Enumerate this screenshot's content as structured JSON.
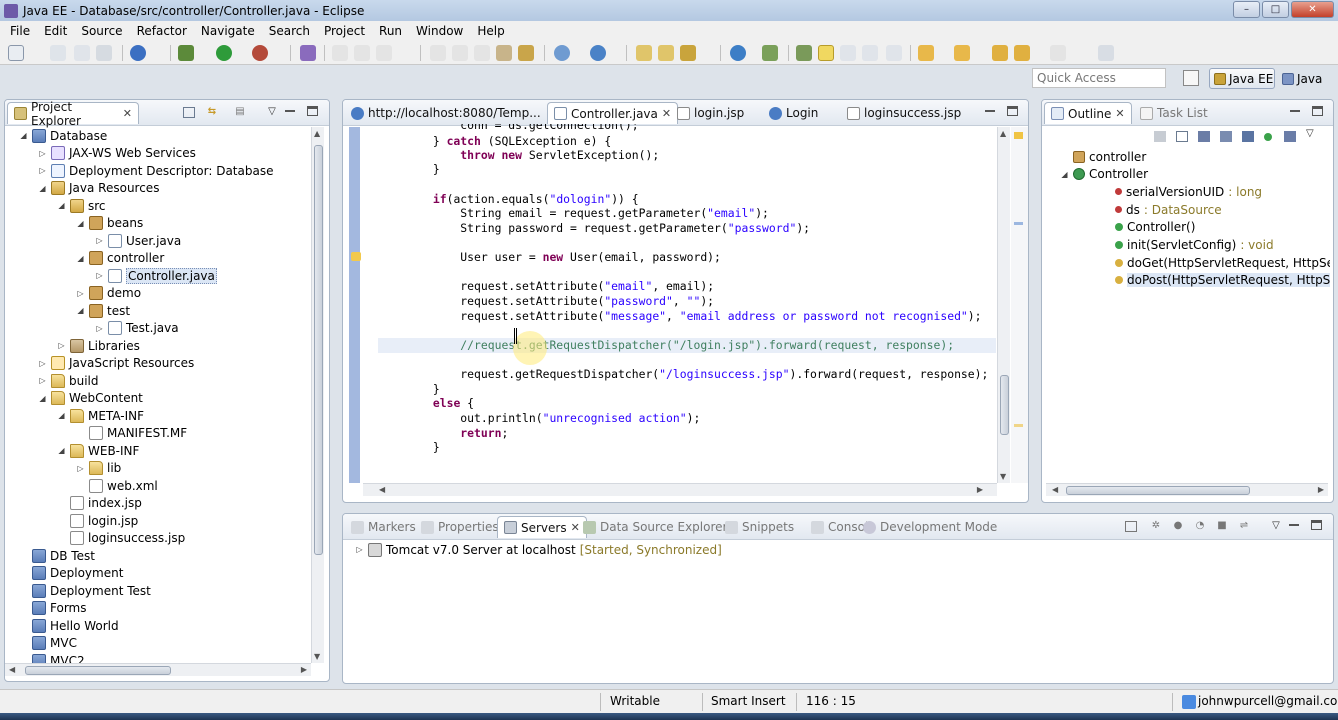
{
  "window": {
    "title": "Java EE - Database/src/controller/Controller.java - Eclipse",
    "controls": [
      "–",
      "□",
      "✕"
    ]
  },
  "menu": [
    "File",
    "Edit",
    "Source",
    "Refactor",
    "Navigate",
    "Search",
    "Project",
    "Run",
    "Window",
    "Help"
  ],
  "quick_access": {
    "placeholder": "Quick Access"
  },
  "perspectives": [
    {
      "label": "Java EE",
      "active": true
    },
    {
      "label": "Java",
      "active": false
    }
  ],
  "project_explorer": {
    "title": "Project Explorer",
    "tree": [
      {
        "label": "Database",
        "icon": "project-icon",
        "twisty": "◢",
        "indent": 0
      },
      {
        "label": "JAX-WS Web Services",
        "icon": "webservice-icon",
        "twisty": "▷",
        "indent": 1
      },
      {
        "label": "Deployment Descriptor: Database",
        "icon": "descriptor-icon",
        "twisty": "▷",
        "indent": 1
      },
      {
        "label": "Java Resources",
        "icon": "java-resources-icon",
        "twisty": "◢",
        "indent": 1
      },
      {
        "label": "src",
        "icon": "source-folder-icon",
        "twisty": "◢",
        "indent": 2
      },
      {
        "label": "beans",
        "icon": "package-icon",
        "twisty": "◢",
        "indent": 3
      },
      {
        "label": "User.java",
        "icon": "java-file-icon",
        "twisty": "▷",
        "indent": 4
      },
      {
        "label": "controller",
        "icon": "package-icon",
        "twisty": "◢",
        "indent": 3
      },
      {
        "label": "Controller.java",
        "icon": "java-file-icon",
        "twisty": "▷",
        "indent": 4,
        "selected": true
      },
      {
        "label": "demo",
        "icon": "package-icon",
        "twisty": "▷",
        "indent": 3
      },
      {
        "label": "test",
        "icon": "package-icon",
        "twisty": "◢",
        "indent": 3
      },
      {
        "label": "Test.java",
        "icon": "java-file-icon",
        "twisty": "▷",
        "indent": 4
      },
      {
        "label": "Libraries",
        "icon": "library-icon",
        "twisty": "▷",
        "indent": 2
      },
      {
        "label": "JavaScript Resources",
        "icon": "javascript-icon",
        "twisty": "▷",
        "indent": 1
      },
      {
        "label": "build",
        "icon": "folder-icon",
        "twisty": "▷",
        "indent": 1
      },
      {
        "label": "WebContent",
        "icon": "folder-icon",
        "twisty": "◢",
        "indent": 1
      },
      {
        "label": "META-INF",
        "icon": "folder-icon",
        "twisty": "◢",
        "indent": 2
      },
      {
        "label": "MANIFEST.MF",
        "icon": "file-icon",
        "twisty": "",
        "indent": 3
      },
      {
        "label": "WEB-INF",
        "icon": "folder-icon",
        "twisty": "◢",
        "indent": 2
      },
      {
        "label": "lib",
        "icon": "folder-icon",
        "twisty": "▷",
        "indent": 3
      },
      {
        "label": "web.xml",
        "icon": "xml-file-icon",
        "twisty": "",
        "indent": 3
      },
      {
        "label": "index.jsp",
        "icon": "file-icon",
        "twisty": "",
        "indent": 2
      },
      {
        "label": "login.jsp",
        "icon": "file-icon",
        "twisty": "",
        "indent": 2
      },
      {
        "label": "loginsuccess.jsp",
        "icon": "file-icon",
        "twisty": "",
        "indent": 2
      },
      {
        "label": "DB Test",
        "icon": "project-icon",
        "twisty": "",
        "indent": 0
      },
      {
        "label": "Deployment",
        "icon": "project-icon",
        "twisty": "",
        "indent": 0
      },
      {
        "label": "Deployment Test",
        "icon": "project-icon",
        "twisty": "",
        "indent": 0
      },
      {
        "label": "Forms",
        "icon": "project-icon",
        "twisty": "",
        "indent": 0
      },
      {
        "label": "Hello World",
        "icon": "project-icon",
        "twisty": "",
        "indent": 0
      },
      {
        "label": "MVC",
        "icon": "project-icon",
        "twisty": "",
        "indent": 0
      },
      {
        "label": "MVC2",
        "icon": "project-icon",
        "twisty": "",
        "indent": 0
      }
    ]
  },
  "editor": {
    "tabs": [
      {
        "label": "http://localhost:8080/Temp...",
        "icon": "browser-icon",
        "active": false
      },
      {
        "label": "Controller.java",
        "icon": "java-file-icon",
        "active": true
      },
      {
        "label": "login.jsp",
        "icon": "jsp-file-icon",
        "active": false
      },
      {
        "label": "Login",
        "icon": "browser-icon",
        "active": false
      },
      {
        "label": "loginsuccess.jsp",
        "icon": "jsp-file-icon",
        "active": false
      }
    ],
    "code": [
      {
        "text": "            conn = ds.getConnection();",
        "parts": []
      },
      {
        "text": "        } catch (SQLException e) {",
        "parts": [
          [
            "        } ",
            ""
          ],
          [
            "catch",
            "k"
          ],
          [
            " (SQLException e) {",
            ""
          ]
        ]
      },
      {
        "text": "            throw new ServletException();",
        "parts": [
          [
            "            ",
            ""
          ],
          [
            "throw",
            "k"
          ],
          [
            " ",
            ""
          ],
          [
            "new",
            "k"
          ],
          [
            " ServletException();",
            ""
          ]
        ]
      },
      {
        "text": "        }",
        "parts": []
      },
      {
        "text": "",
        "parts": []
      },
      {
        "text": "        if(action.equals(\"dologin\")) {",
        "parts": [
          [
            "        ",
            ""
          ],
          [
            "if",
            "k"
          ],
          [
            "(action.equals(",
            ""
          ],
          [
            "\"dologin\"",
            "s"
          ],
          [
            ")) {",
            ""
          ]
        ]
      },
      {
        "text": "            String email = request.getParameter(\"email\");",
        "parts": [
          [
            "            String email = request.getParameter(",
            ""
          ],
          [
            "\"email\"",
            "s"
          ],
          [
            ");",
            ""
          ]
        ]
      },
      {
        "text": "            String password = request.getParameter(\"password\");",
        "parts": [
          [
            "            String password = request.getParameter(",
            ""
          ],
          [
            "\"password\"",
            "s"
          ],
          [
            ");",
            ""
          ]
        ]
      },
      {
        "text": "",
        "parts": []
      },
      {
        "text": "            User user = new User(email, password);",
        "parts": [
          [
            "            User user = ",
            ""
          ],
          [
            "new",
            "k"
          ],
          [
            " User(email, password);",
            ""
          ]
        ]
      },
      {
        "text": "",
        "parts": []
      },
      {
        "text": "            request.setAttribute(\"email\", email);",
        "parts": [
          [
            "            request.setAttribute(",
            ""
          ],
          [
            "\"email\"",
            "s"
          ],
          [
            ", email);",
            ""
          ]
        ]
      },
      {
        "text": "            request.setAttribute(\"password\", \"\");",
        "parts": [
          [
            "            request.setAttribute(",
            ""
          ],
          [
            "\"password\"",
            "s"
          ],
          [
            ", ",
            ""
          ],
          [
            "\"\"",
            "s"
          ],
          [
            ");",
            ""
          ]
        ]
      },
      {
        "text": "            request.setAttribute(\"message\", \"email address or password not recognised\");",
        "parts": [
          [
            "            request.setAttribute(",
            ""
          ],
          [
            "\"message\"",
            "s"
          ],
          [
            ", ",
            ""
          ],
          [
            "\"email address or password not recognised\"",
            "s"
          ],
          [
            ");",
            ""
          ]
        ]
      },
      {
        "text": "",
        "parts": []
      },
      {
        "text": "            //request.getRequestDispatcher(\"/login.jsp\").forward(request, response);",
        "parts": [
          [
            "            ",
            ""
          ],
          [
            "//request.getRequestDispatcher(\"/login.jsp\").forward(request, response);",
            "c"
          ]
        ],
        "highlight": true
      },
      {
        "text": "",
        "parts": []
      },
      {
        "text": "            request.getRequestDispatcher(\"/loginsuccess.jsp\").forward(request, response);",
        "parts": [
          [
            "            request.getRequestDispatcher(",
            ""
          ],
          [
            "\"/loginsuccess.jsp\"",
            "s"
          ],
          [
            ").forward(request, response);",
            ""
          ]
        ]
      },
      {
        "text": "        }",
        "parts": []
      },
      {
        "text": "        else {",
        "parts": [
          [
            "        ",
            ""
          ],
          [
            "else",
            "k"
          ],
          [
            " {",
            ""
          ]
        ]
      },
      {
        "text": "            out.println(\"unrecognised action\");",
        "parts": [
          [
            "            out.println(",
            ""
          ],
          [
            "\"unrecognised action\"",
            "s"
          ],
          [
            ");",
            ""
          ]
        ]
      },
      {
        "text": "            return;",
        "parts": [
          [
            "            ",
            ""
          ],
          [
            "return",
            "k"
          ],
          [
            ";",
            ""
          ]
        ]
      },
      {
        "text": "        }",
        "parts": []
      }
    ]
  },
  "outline": {
    "tabs": [
      {
        "label": "Outline",
        "icon": "outline-icon",
        "active": true
      },
      {
        "label": "Task List",
        "icon": "task-list-icon",
        "active": false
      }
    ],
    "items": [
      {
        "label": "controller",
        "type": "",
        "icon": "package-icon",
        "indent": 0,
        "twisty": ""
      },
      {
        "label": "Controller",
        "type": "",
        "icon": "class-icon",
        "indent": 0,
        "twisty": "◢"
      },
      {
        "label": "serialVersionUID",
        "type": " : long",
        "icon": "static-final-field-icon",
        "indent": 1,
        "twisty": ""
      },
      {
        "label": "ds",
        "type": " : DataSource",
        "icon": "private-field-icon",
        "indent": 1,
        "twisty": ""
      },
      {
        "label": "Controller()",
        "type": "",
        "icon": "constructor-icon",
        "indent": 1,
        "twisty": ""
      },
      {
        "label": "init(ServletConfig)",
        "type": " : void",
        "icon": "public-method-icon",
        "indent": 1,
        "twisty": ""
      },
      {
        "label": "doGet(HttpServletRequest, HttpServletR",
        "type": "",
        "icon": "protected-method-icon",
        "indent": 1,
        "twisty": ""
      },
      {
        "label": "doPost(HttpServletRequest, HttpServletR",
        "type": "",
        "icon": "protected-method-icon",
        "indent": 1,
        "twisty": "",
        "selected": true
      }
    ]
  },
  "bottom_panel": {
    "tabs": [
      {
        "label": "Markers",
        "icon": "markers-icon",
        "active": false
      },
      {
        "label": "Properties",
        "icon": "properties-icon",
        "active": false
      },
      {
        "label": "Servers",
        "icon": "servers-icon",
        "active": true
      },
      {
        "label": "Data Source Explorer",
        "icon": "data-source-icon",
        "active": false
      },
      {
        "label": "Snippets",
        "icon": "snippets-icon",
        "active": false
      },
      {
        "label": "Console",
        "icon": "console-icon",
        "active": false
      },
      {
        "label": "Development Mode",
        "icon": "development-mode-icon",
        "active": false
      }
    ],
    "server": {
      "name": "Tomcat v7.0 Server at localhost",
      "status": "[Started, Synchronized]"
    }
  },
  "status_bar": {
    "writable": "Writable",
    "insert_mode": "Smart Insert",
    "position": "116 : 15",
    "account": "johnwpurcell@gmail.com"
  },
  "colors": {
    "keyword": "#7f0055",
    "string": "#2a00ff",
    "comment": "#3f7f5f"
  }
}
